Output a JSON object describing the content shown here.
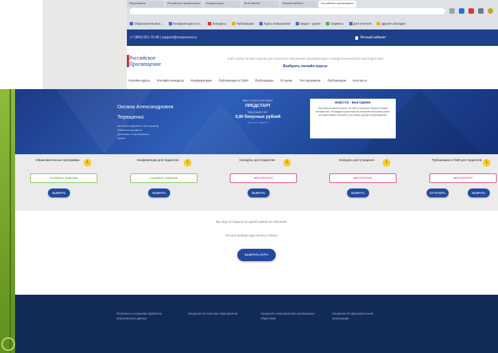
{
  "browser": {
    "tabs": [
      "Образование",
      "Российское просвещение",
      "Конференции",
      "Мой кабинет",
      "Личный кабинет",
      "Российское просвещение"
    ],
    "bookmarks": [
      "Образовательные...",
      "Конференции и ко...",
      "Конкурсы",
      "Публикации",
      "Курсы повышения",
      "Видео - уроки",
      "Сервисы",
      "Для учителя",
      "Другие закладки"
    ]
  },
  "site": {
    "topbar": {
      "contacts": "+7 (800) 551-70-48 | support@rosprosvet.ru",
      "cabinet_label": "Личный кабинет"
    },
    "logo": {
      "line1": "Российское",
      "line2": "Просвещение"
    },
    "tagline": "Сайт-набор онлайн-курсов для педагогов повышения квалификации и профессиональной переподготовки",
    "subtitle": "Выбрать онлайн-курсы",
    "nav": [
      "Онлайн-курсы",
      "Онлайн-конкурсы",
      "Конференции",
      "Публикации в СМИ",
      "Публикации",
      "Отзывы",
      "Тестирование",
      "Публикации",
      "Контакты"
    ]
  },
  "profile": {
    "name_line1": "Оксана Александровна",
    "name_line2": "Терещенко",
    "info": [
      "alexandrova@mail.ru (Не указан)",
      "Изменить профиль",
      "Дипломы и сертификаты",
      "Выйти"
    ],
    "status": {
      "label": "Ваш статус участника:",
      "value": "ПРЕДСТАРТ",
      "balance_label": "Бонусный счет:",
      "balance": "0,00 бонусных рублей",
      "note": "(Что это такое?)"
    },
    "promo": {
      "title": "ВМЕСТЕ - ВЫГОДНЕЕ",
      "text": "Пригласите ваших коллег на сайт и получите бонусы на ваш личный счет. За каждого участника вы получите бонусные рубли, которые можно потратить на оплату курсов и мероприятий."
    }
  },
  "categories": [
    {
      "title": "Образовательные программы",
      "badge": "1",
      "status": "Активные тематики",
      "status_color": "green",
      "buttons": [
        "ВЫБРАТЬ"
      ]
    },
    {
      "title": "Конференции для педагогов",
      "badge": "1",
      "status": "Активные тематики",
      "status_color": "green",
      "buttons": [
        "ВЫБРАТЬ"
      ]
    },
    {
      "title": "Конкурсы для педагогов",
      "badge": "1",
      "status": "БЕСПЛАТНО",
      "status_color": "pink",
      "buttons": [
        "ВЫБРАТЬ"
      ]
    },
    {
      "title": "Конкурсы для учащихся",
      "badge": "1",
      "status": "БЕСПЛАТНО",
      "status_color": "pink",
      "buttons": [
        "ВЫБРАТЬ"
      ]
    },
    {
      "title": "Публикации в СМИ для педагогов",
      "badge": "1",
      "status": "БЕСПЛАТНО",
      "status_color": "pink",
      "buttons": [
        "ЗАГРУЗИТЬ",
        "ВЫБРАТЬ"
      ]
    }
  ],
  "main": {
    "line1": "Вы еще не подали ни одной заявки на обучение.",
    "line2": "Оплата выбора курс начать сейчас!",
    "button": "ВЫБРАТЬ КУРС"
  },
  "footer": {
    "links": [
      "Политика в отношении обработки персональных данных",
      "Сведения об участнике мероприятия",
      "Сведения о мероприятиях реализуемых обществом",
      "Сведения об образовательной организации"
    ]
  },
  "colors": {
    "primary": "#1e3f8b",
    "button": "#234a9c",
    "free": "#e04a8f",
    "active": "#7cc85d",
    "footer": "#112a56",
    "accent_green": "#8dbb3a"
  }
}
